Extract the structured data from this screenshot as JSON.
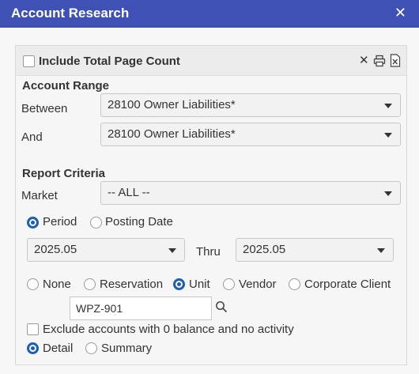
{
  "window": {
    "title": "Account Research",
    "close_icon": "close-icon"
  },
  "header": {
    "include_total_label": "Include Total Page Count"
  },
  "account_range": {
    "heading": "Account Range",
    "between_label": "Between",
    "between_value": "28100 Owner Liabilities*",
    "and_label": "And",
    "and_value": "28100 Owner Liabilities*"
  },
  "report_criteria": {
    "heading": "Report Criteria",
    "market_label": "Market",
    "market_value": "-- ALL --",
    "period_label": "Period",
    "posting_date_label": "Posting Date",
    "selected_basis": "Period",
    "from_value": "2025.05",
    "thru_label": "Thru",
    "thru_value": "2025.05",
    "filter_options": [
      "None",
      "Reservation",
      "Unit",
      "Vendor",
      "Corporate Client"
    ],
    "selected_filter": "Unit",
    "filter_input_value": "WPZ-901",
    "exclude_label": "Exclude accounts with 0 balance and no activity",
    "detail_label": "Detail",
    "summary_label": "Summary",
    "selected_detail": "Detail"
  },
  "colors": {
    "titlebar": "#3f51b5",
    "radio_selected": "#1a5fb4"
  }
}
